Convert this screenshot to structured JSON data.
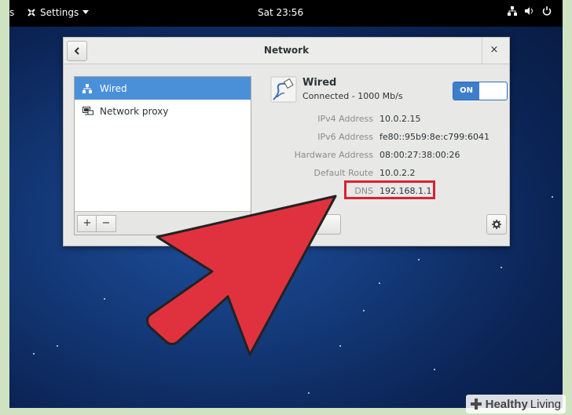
{
  "topbar": {
    "left_fragment": "s",
    "app_menu": "Settings",
    "clock": "Sat 23:56",
    "tray_icons": [
      "network-icon",
      "volume-icon",
      "power-icon"
    ]
  },
  "dialog": {
    "title": "Network",
    "close_symbol": "×",
    "back_symbol": "‹"
  },
  "sidebar": {
    "items": [
      {
        "label": "Wired",
        "icon": "wired-network-icon",
        "selected": true
      },
      {
        "label": "Network proxy",
        "icon": "network-proxy-icon",
        "selected": false
      }
    ],
    "add_label": "+",
    "remove_label": "−"
  },
  "connection": {
    "name": "Wired",
    "status": "Connected - 1000 Mb/s",
    "toggle_label": "ON",
    "toggle_on": true,
    "properties": [
      {
        "label": "IPv4 Address",
        "value": "10.0.2.15"
      },
      {
        "label": "IPv6 Address",
        "value": "fe80::95b9:8e:c799:6041"
      },
      {
        "label": "Hardware Address",
        "value": "08:00:27:38:00:26"
      },
      {
        "label": "Default Route",
        "value": "10.0.2.2"
      },
      {
        "label": "DNS",
        "value": "192.168.1.1"
      }
    ]
  },
  "annotation": {
    "highlight_color": "#d9222f",
    "arrow_color": "#e0323e"
  },
  "watermark": {
    "brand_bold": "Healthy",
    "brand_rest": " Living"
  },
  "colors": {
    "accent": "#4a90d9",
    "toggle_on": "#3d7dcc"
  }
}
